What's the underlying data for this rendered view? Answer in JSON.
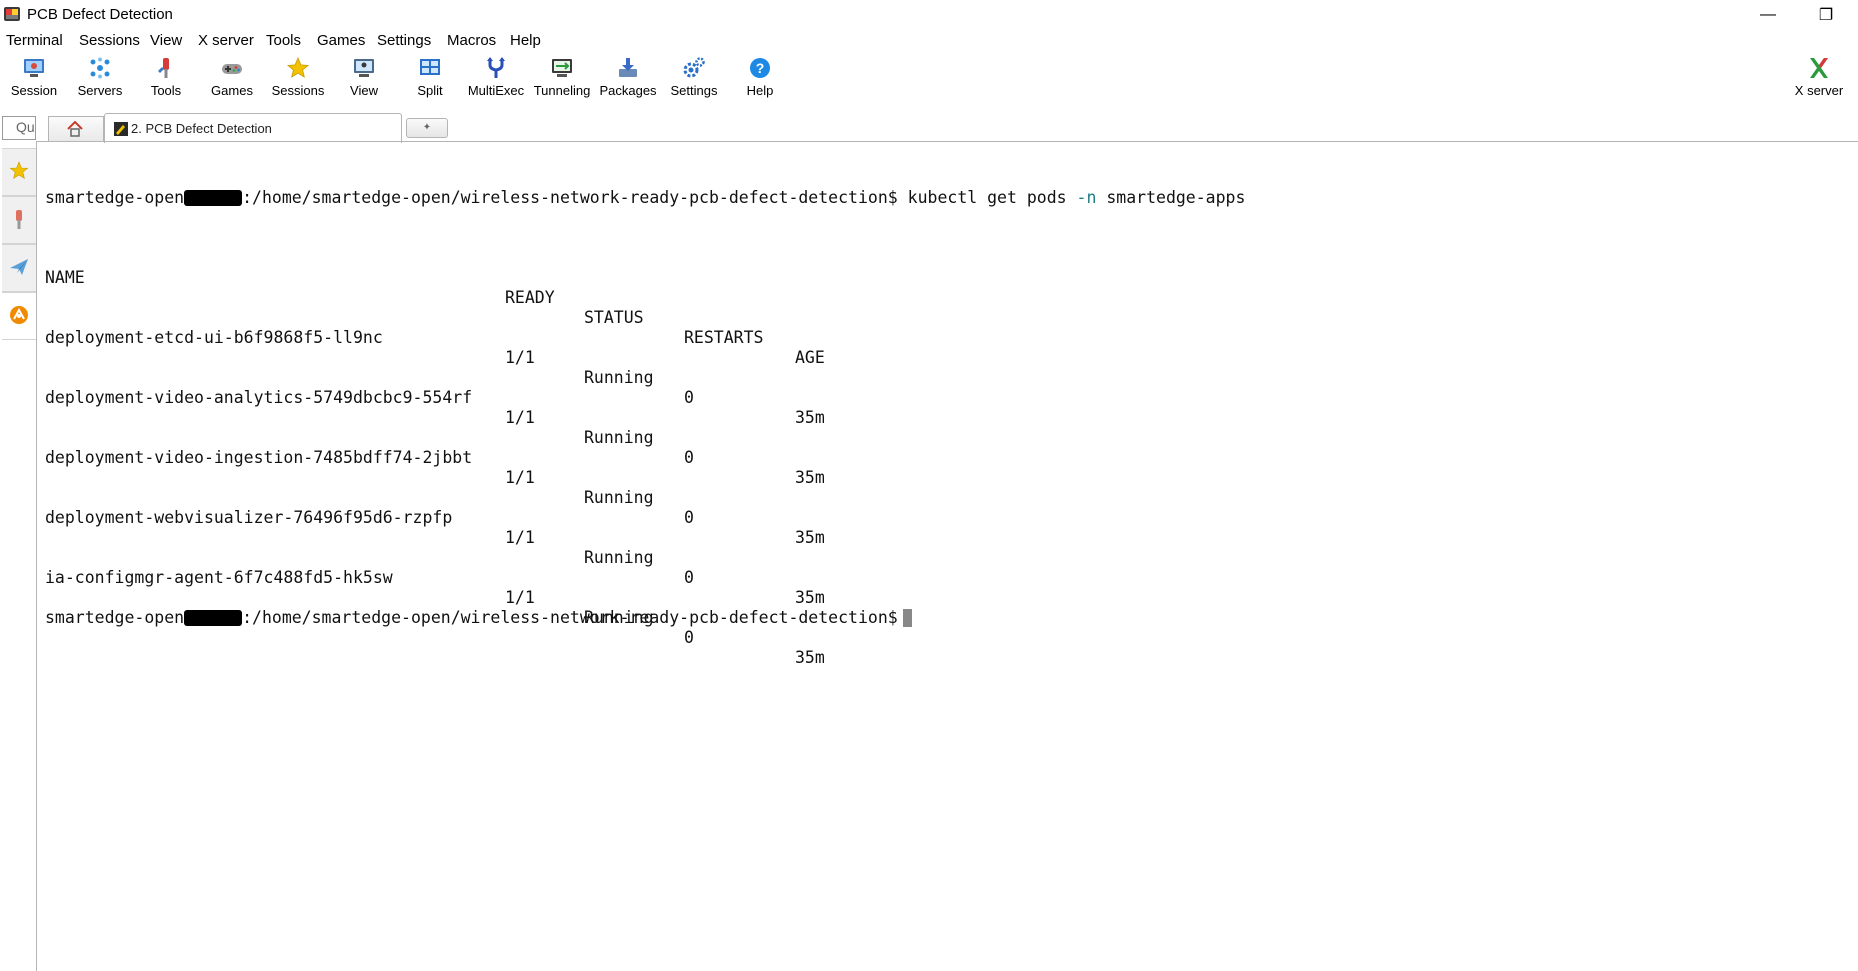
{
  "window": {
    "title": "PCB Defect Detection",
    "minimize_symbol": "—",
    "restore_symbol": "❐"
  },
  "menu": [
    "Terminal",
    "Sessions",
    "View",
    "X server",
    "Tools",
    "Games",
    "Settings",
    "Macros",
    "Help"
  ],
  "toolbar": {
    "session": "Session",
    "servers": "Servers",
    "tools": "Tools",
    "games": "Games",
    "sessions": "Sessions",
    "view": "View",
    "split": "Split",
    "multiexec": "MultiExec",
    "tunneling": "Tunneling",
    "packages": "Packages",
    "settings": "Settings",
    "help": "Help",
    "xserver": "X server"
  },
  "tabs": {
    "quick_connect": "Qu",
    "active_tab": "2. PCB Defect Detection",
    "new_tab_symbol": "✦"
  },
  "terminal": {
    "prompt_user": "smartedge-open",
    "prompt_path": ":/home/smartedge-open/wireless-network-ready-pcb-defect-detection$",
    "command": " kubectl get pods ",
    "command_flag": "-n",
    "command_arg": " smartedge-apps",
    "headers": {
      "name": "NAME",
      "ready": "READY",
      "status": "STATUS",
      "restarts": "RESTARTS",
      "age": "AGE"
    },
    "pods": [
      {
        "name": "deployment-etcd-ui-b6f9868f5-ll9nc",
        "ready": "1/1",
        "status": "Running",
        "restarts": "0",
        "age": "35m"
      },
      {
        "name": "deployment-video-analytics-5749dbcbc9-554rf",
        "ready": "1/1",
        "status": "Running",
        "restarts": "0",
        "age": "35m"
      },
      {
        "name": "deployment-video-ingestion-7485bdff74-2jbbt",
        "ready": "1/1",
        "status": "Running",
        "restarts": "0",
        "age": "35m"
      },
      {
        "name": "deployment-webvisualizer-76496f95d6-rzpfp",
        "ready": "1/1",
        "status": "Running",
        "restarts": "0",
        "age": "35m"
      },
      {
        "name": "ia-configmgr-agent-6f7c488fd5-hk5sw",
        "ready": "1/1",
        "status": "Running",
        "restarts": "0",
        "age": "35m"
      }
    ]
  }
}
